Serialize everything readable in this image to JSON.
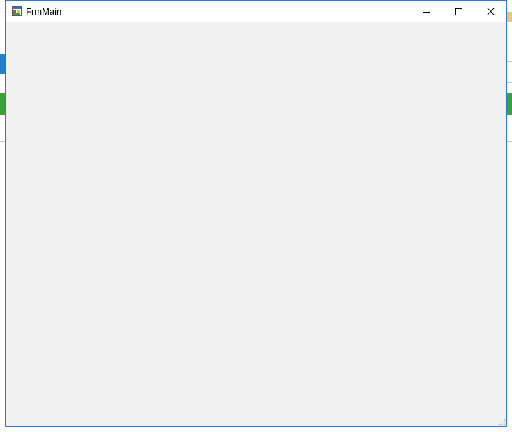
{
  "window": {
    "title": "FrmMain"
  },
  "icons": {
    "app": "app-window-icon",
    "minimize": "minimize-icon",
    "maximize": "maximize-icon",
    "close": "close-icon",
    "grip": "resize-grip-icon"
  },
  "colors": {
    "window_border": "#2b78d0",
    "titlebar_bg": "#ffffff",
    "client_bg": "#f0f0f0",
    "background_green": "#3aa13a",
    "background_blue": "#1f7fd0"
  }
}
